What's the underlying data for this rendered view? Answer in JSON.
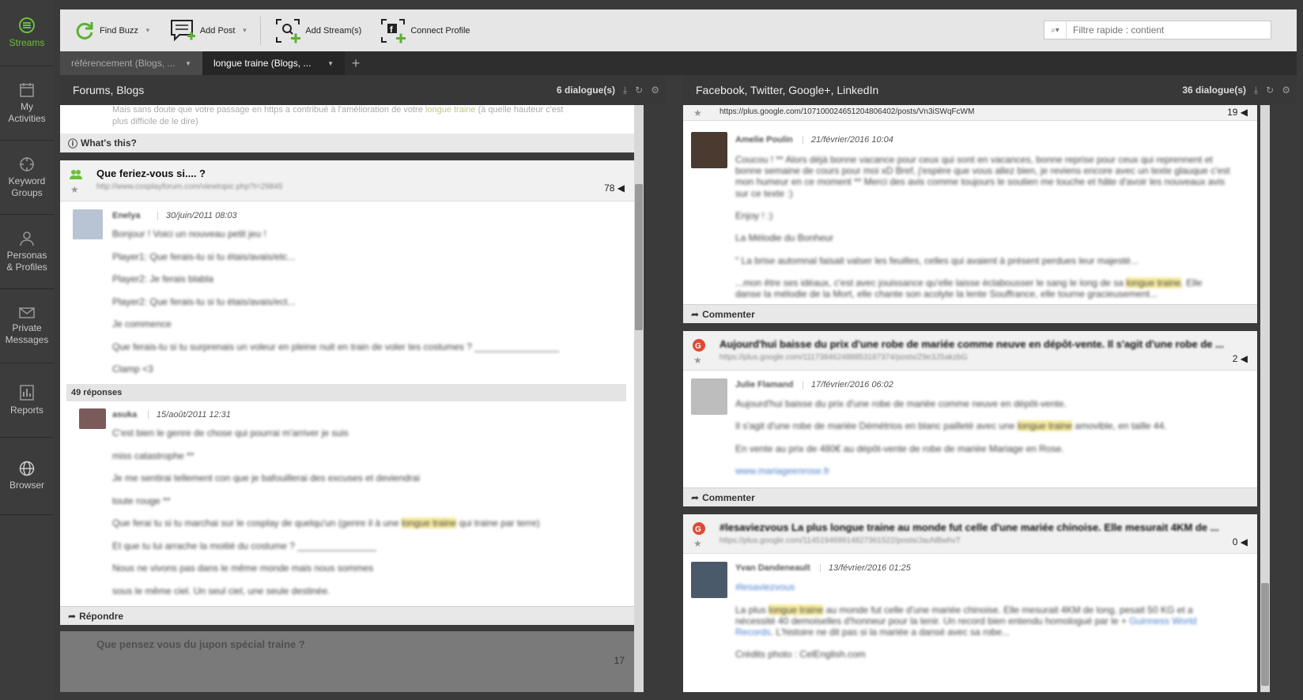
{
  "nav": {
    "items": [
      {
        "label": "Streams",
        "icon": "streams-icon",
        "active": true
      },
      {
        "label": "My\nActivities",
        "icon": "calendar-icon"
      },
      {
        "label": "Keyword\nGroups",
        "icon": "target-icon"
      },
      {
        "label": "Personas\n& Profiles",
        "icon": "person-icon"
      },
      {
        "label": "Private\nMessages",
        "icon": "envelope-icon"
      },
      {
        "label": "Reports",
        "icon": "report-icon"
      },
      {
        "label": "Browser",
        "icon": "globe-icon"
      }
    ]
  },
  "toolbar": {
    "find_buzz": "Find Buzz",
    "add_post": "Add Post",
    "add_streams": "Add Stream(s)",
    "connect_profile": "Connect Profile",
    "filter_placeholder": "Filtre rapide : contient"
  },
  "tabs": [
    {
      "label": "référencement (Blogs, ..."
    },
    {
      "label": "longue traine (Blogs, ...",
      "active": true
    }
  ],
  "colors": {
    "accent_green": "#6cbf3a",
    "highlight": "#f7ec9e",
    "google_red": "#dd4b39"
  },
  "left_panel": {
    "title": "Forums, Blogs",
    "count": "6 dialogue(s)",
    "top_snippet_1": "Mais sans doute que votre passage en https a contribué à l'amélioration de votre",
    "top_snippet_hl": "longue traine",
    "top_snippet_2": "(à quelle hauteur c'est",
    "top_snippet_3": "plus difficile de le dire)",
    "whats_this": "What's this?",
    "post": {
      "title": "Que feriez-vous si.... ?",
      "url": "http://www.cosplayforum.com/viewtopic.php?t=29845",
      "count": "78",
      "author": "Enelya",
      "date": "30/juin/2011 08:03",
      "lines": [
        "Bonjour ! Voici un nouveau petit jeu !",
        "Player1: Que ferais-tu si tu étais/avais/etc...",
        "Player2: Je ferais blabla",
        "Player2: Que ferais-tu si tu étais/avais/ect...",
        "Je commence",
        "Que ferais-tu si tu surprenais un voleur en pleine nuit en train de voler tes costumes ? ________________",
        "Clamp <3"
      ],
      "replies_label": "49 réponses",
      "reply": {
        "author": "asuka",
        "date": "15/août/2011 12:31",
        "lines": [
          "C'est bien le genre de chose qui pourrai m'arriver je suis",
          "miss catastrophe **",
          "Je me sentirai tellement con que je bafouillerai des excuses et deviendrai",
          "toute rouge **",
          "Et que tu lui arrache la moitié du costume ? _______________",
          "Nous ne vivons pas dans le même monde mais nous sommes",
          "sous le même ciel. Un seul ciel, une seule destinée."
        ],
        "hl_line_1": "Que ferai tu si tu marchai sur le cosplay de quelqu'un (genre il à une",
        "hl_word": "longue traine",
        "hl_line_2": "qui traine par terre)"
      },
      "reply_action": "Répondre"
    },
    "next_post_title": "Que pensez vous du jupon spécial traine ?",
    "next_post_count": "17"
  },
  "right_panel": {
    "title": "Facebook, Twitter, Google+, LinkedIn",
    "count": "36 dialogue(s)",
    "card1": {
      "url": "https://plus.google.com/107100024651204806402/posts/Vn3iSWqFcWM",
      "count": "19",
      "author": "Amelie Poulin",
      "date": "21/février/2016 10:04",
      "lines": [
        "Coucou ! ** Alors déjà bonne vacance pour ceux qui sont en vacances, bonne reprise pour ceux qui reprennent et",
        "bonne semaine de cours pour moi xD Bref, j'espère que vous allez bien, je reviens encore avec un texte glauque c'est",
        "mon humeur en ce moment ** Merci des avis comme toujours le soutien me touche et hâte d'avoir les nouveaux avis",
        "sur ce texte :)",
        "Enjoy ! :)",
        "La Mélodie du Bonheur",
        "\" La brise automnal faisait valser les feuilles, celles qui avaient à présent perdues leur majesté..."
      ],
      "hl_line_1": "...mon être ses idéaux, c'est avec jouissance qu'elle laisse éclabousser le sang le long de sa",
      "hl_word": "longue traine",
      "hl_line_2": ". Elle",
      "last_line": "danse la mélodie de la Mort, elle chante son acolyte la lente Souffrance, elle tourne gracieusement...",
      "action": "Commenter"
    },
    "card2": {
      "title": "Aujourd'hui baisse du prix d'une robe de mariée comme neuve en dépôt-vente. Il s'agit d'une robe de ...",
      "url": "https://plus.google.com/111738462488853187374/posts/Z9e3JSakzbG",
      "count": "2",
      "author": "Julie Flamand",
      "date": "17/février/2016 06:02",
      "line1": "Aujourd'hui baisse du prix d'une robe de mariée comme neuve en dépôt-vente.",
      "hl_line_1": "Il s'agit d'une robe de mariée Démétrios en blanc pailleté avec une",
      "hl_word": "longue traine",
      "hl_line_2": "amovible, en taille 44.",
      "line3": "En vente au prix de 480€ au dépôt-vente de robe de mariée Mariage en Rose.",
      "link": "www.mariageenrose.fr",
      "action": "Commenter"
    },
    "card3": {
      "title": "#lesaviezvous La plus longue traine au monde fut celle d'une mariée chinoise. Elle mesurait 4KM de ...",
      "url": "https://plus.google.com/114519469914827361522/posts/JauNBwhvT",
      "count": "0",
      "author": "Yvan Dandeneault",
      "date": "13/février/2016 01:25",
      "hashtag": "#lesaviezvous",
      "hl_line_1": "La plus",
      "hl_word": "longue traine",
      "hl_line_2": "au monde fut celle d'une mariée chinoise. Elle mesurait 4KM de long, pesait 50 KG et a",
      "line2a": "nécessité 40 demoiselles d'honneur pour la tenir. Un record bien entendu homologué par le +",
      "line2_link": "Guinness World",
      "line3_link": "Records",
      "line3": ". L'histoire ne dit pas si la mariée a dansé avec sa robe...",
      "line4": "Crédits photo : CelEnglish.com"
    }
  }
}
